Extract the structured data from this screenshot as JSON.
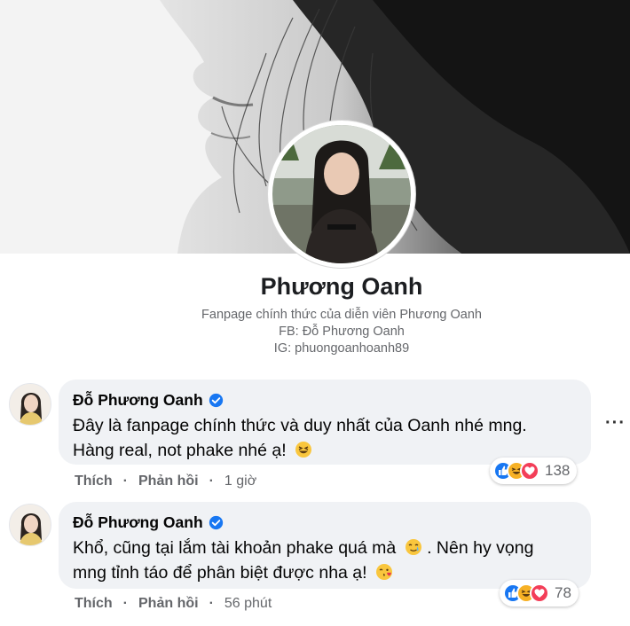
{
  "page": {
    "name": "Phương Oanh",
    "bio_line1": "Fanpage chính thức của diễn viên Phương Oanh",
    "bio_line2": "FB: Đỗ Phương Oanh",
    "bio_line3": "IG: phuongoanhoanh89"
  },
  "comments": [
    {
      "author": "Đỗ Phương Oanh",
      "text_line1": "Đây là fanpage chính thức và duy nhất của Oanh nhé mng.",
      "text_line2": "Hàng real, not phake nhé ạ!",
      "emoji": "grinning-squinting-face",
      "reaction_count": "138",
      "like_label": "Thích",
      "reply_label": "Phản hồi",
      "time": "1 giờ"
    },
    {
      "author": "Đỗ Phương Oanh",
      "text_line1": "Khổ, cũng tại lắm tài khoản phake quá mà",
      "text_line1b": ". Nên hy vọng",
      "text_line2": "mng tỉnh táo để phân biệt được nha ạ!",
      "emoji1": "crying-smile-face",
      "emoji2": "blowing-kiss-face",
      "reaction_count": "78",
      "like_label": "Thích",
      "reply_label": "Phản hồi",
      "time": "56 phút"
    }
  ],
  "more_menu": "···",
  "colors": {
    "like_blue": "#1877f2",
    "haha_yellow": "#f7b125",
    "love_red": "#f33e58",
    "verified_blue": "#1877f2",
    "bubble_bg": "#f0f2f5"
  }
}
